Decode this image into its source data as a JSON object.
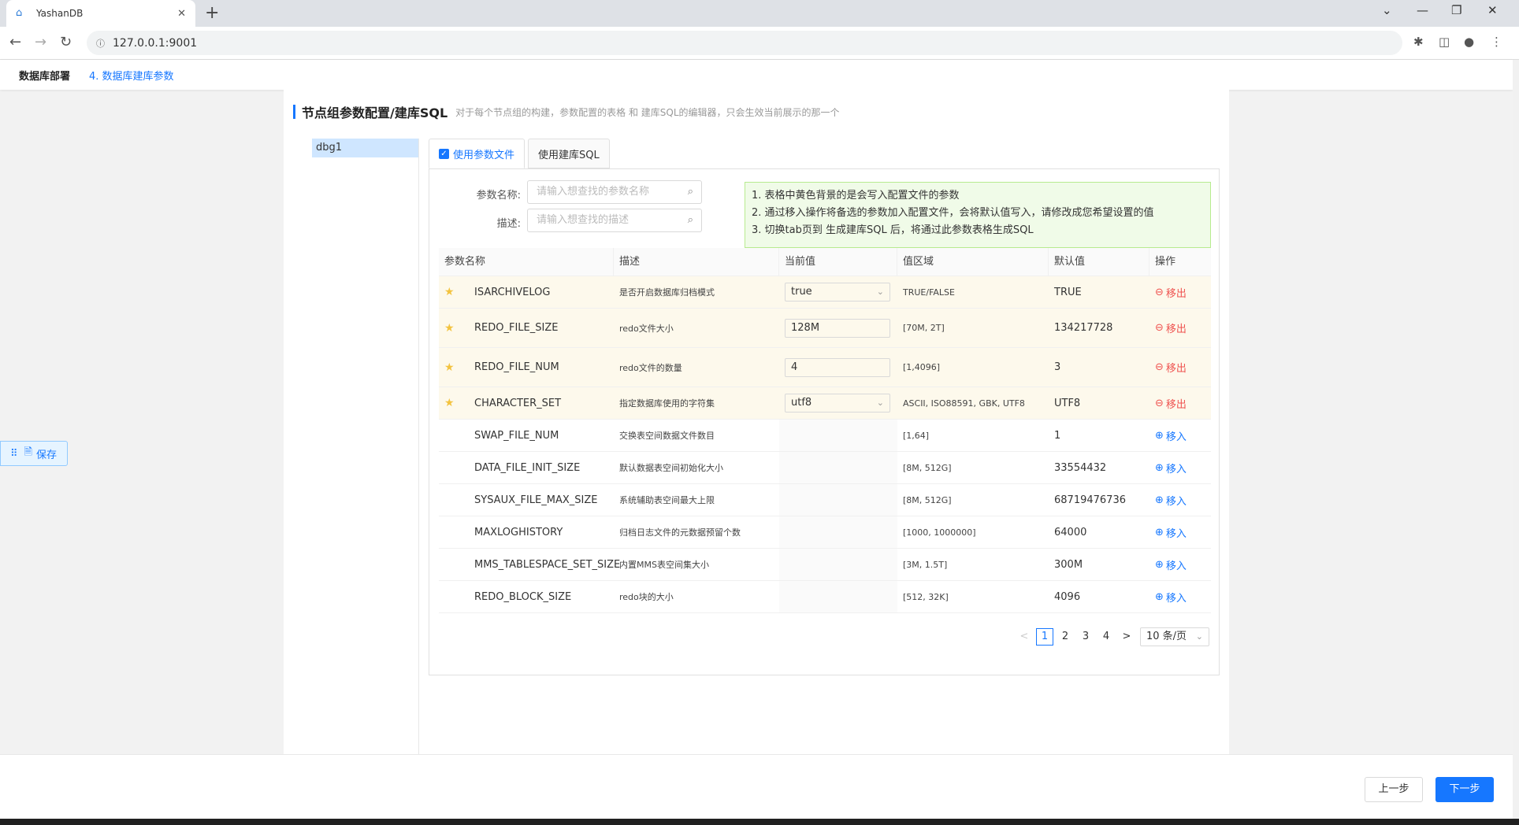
{
  "browser": {
    "tab_title": "YashanDB",
    "new_tab": "+",
    "url": "127.0.0.1:9001"
  },
  "header": {
    "brand": "数据库部署",
    "step": "4. 数据库建库参数"
  },
  "section": {
    "title": "节点组参数配置/建库SQL",
    "desc": "对于每个节点组的构建，参数配置的表格 和 建库SQL的编辑器，只会生效当前展示的那一个"
  },
  "groups": [
    "dbg1"
  ],
  "tabs": {
    "param_file": "使用参数文件",
    "sql": "使用建库SQL"
  },
  "filters": {
    "name_label": "参数名称:",
    "name_placeholder": "请输入想查找的参数名称",
    "desc_label": "描述:",
    "desc_placeholder": "请输入想查找的描述"
  },
  "tips": [
    "1. 表格中黄色背景的是会写入配置文件的参数",
    "2. 通过移入操作将备选的参数加入配置文件，会将默认值写入，请修改成您希望设置的值",
    "3. 切换tab页到 生成建库SQL 后，将通过此参数表格生成SQL"
  ],
  "table": {
    "headers": [
      "参数名称",
      "描述",
      "当前值",
      "值区域",
      "默认值",
      "操作"
    ],
    "rows": [
      {
        "name": "ISARCHIVELOG",
        "desc": "是否开启数据库归档模式",
        "value": "true",
        "range": "TRUE/FALSE",
        "default": "TRUE",
        "op": "移出"
      },
      {
        "name": "REDO_FILE_SIZE",
        "desc": "redo文件大小",
        "value": "128M",
        "range": "[70M, 2T]",
        "default": "134217728",
        "op": "移出"
      },
      {
        "name": "REDO_FILE_NUM",
        "desc": "redo文件的数量",
        "value": "4",
        "range": "[1,4096]",
        "default": "3",
        "op": "移出"
      },
      {
        "name": "CHARACTER_SET",
        "desc": "指定数据库使用的字符集",
        "value": "utf8",
        "range": "ASCII, ISO88591, GBK, UTF8",
        "default": "UTF8",
        "op": "移出"
      },
      {
        "name": "SWAP_FILE_NUM",
        "desc": "交换表空间数据文件数目",
        "value": "",
        "range": "[1,64]",
        "default": "1",
        "op": "移入"
      },
      {
        "name": "DATA_FILE_INIT_SIZE",
        "desc": "默认数据表空间初始化大小",
        "value": "",
        "range": "[8M, 512G]",
        "default": "33554432",
        "op": "移入"
      },
      {
        "name": "SYSAUX_FILE_MAX_SIZE",
        "desc": "系统辅助表空间最大上限",
        "value": "",
        "range": "[8M, 512G]",
        "default": "68719476736",
        "op": "移入"
      },
      {
        "name": "MAXLOGHISTORY",
        "desc": "归档日志文件的元数据预留个数",
        "value": "",
        "range": "[1000, 1000000]",
        "default": "64000",
        "op": "移入"
      },
      {
        "name": "MMS_TABLESPACE_SET_SIZE",
        "desc": "内置MMS表空间集大小",
        "value": "",
        "range": "[3M, 1.5T]",
        "default": "300M",
        "op": "移入"
      },
      {
        "name": "REDO_BLOCK_SIZE",
        "desc": "redo块的大小",
        "value": "",
        "range": "[512, 32K]",
        "default": "4096",
        "op": "移入"
      }
    ]
  },
  "pagination": {
    "pages": [
      "1",
      "2",
      "3",
      "4"
    ],
    "current": "1",
    "page_size": "10 条/页",
    "prev": "<",
    "next": ">"
  },
  "save_button": "保存",
  "footer": {
    "prev": "上一步",
    "next": "下一步"
  }
}
